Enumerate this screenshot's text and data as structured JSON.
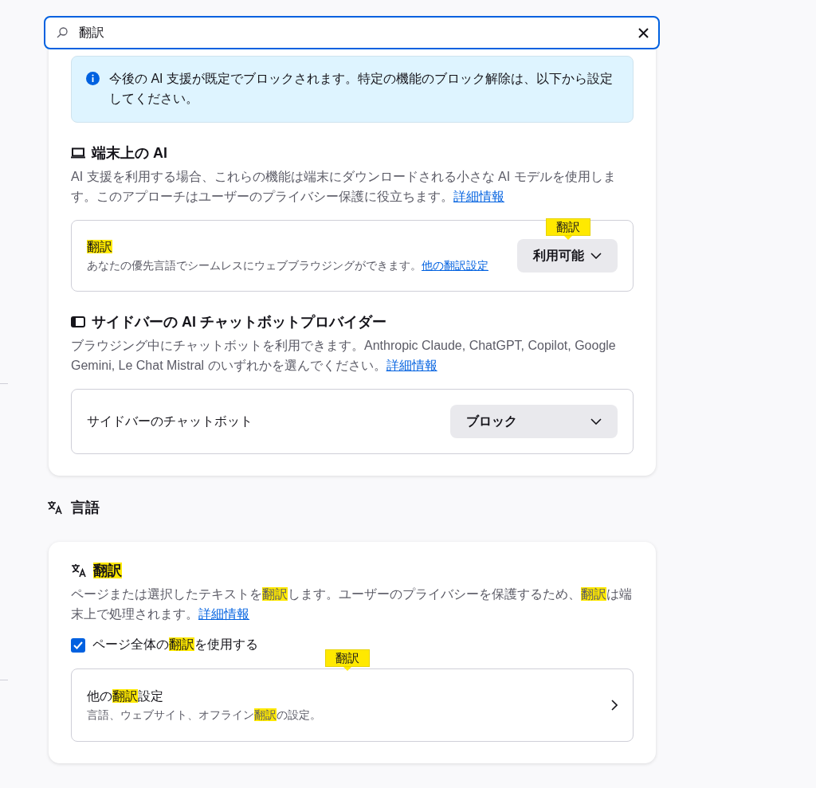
{
  "search": {
    "value": "翻訳"
  },
  "ai_card": {
    "notice": "今後の AI 支援が既定でブロックされます。特定の機能のブロック解除は、以下から設定してください。",
    "sections": [
      {
        "title": "端末上の AI",
        "description": "AI 支援を利用する場合、これらの機能は端末にダウンロードされる小さな AI モデルを使用します。このアプローチはユーザーのプライバシー保護に役立ちます。",
        "link": "詳細情報",
        "setting": {
          "label": [
            {
              "text": "翻訳",
              "highlighted": true
            }
          ],
          "description": "あなたの優先言語でシームレスにウェブブラウジングができます。",
          "link": "他の翻訳設定",
          "dropdown": "利用可能",
          "badge": "翻訳"
        }
      },
      {
        "title": "サイドバーの AI チャットボットプロバイダー",
        "description": "ブラウジング中にチャットボットを利用できます。Anthropic Claude, ChatGPT, Copilot, Google Gemini, Le Chat Mistral のいずれかを選んでください。",
        "link": "詳細情報",
        "setting": {
          "label": [
            {
              "text": "サイドバーのチャットボット",
              "highlighted": false
            }
          ],
          "dropdown": "ブロック"
        }
      }
    ]
  },
  "language": {
    "heading": "言語",
    "card": {
      "title": [
        {
          "text": "翻訳",
          "highlighted": true
        }
      ],
      "description": [
        {
          "text": "ページまたは選択したテキストを",
          "highlighted": false
        },
        {
          "text": "翻訳",
          "highlighted": true
        },
        {
          "text": "します。ユーザーのプライバシーを保護するため、",
          "highlighted": false
        },
        {
          "text": "翻訳",
          "highlighted": true
        },
        {
          "text": "は端末上で処理されます。",
          "highlighted": false
        }
      ],
      "link": "詳細情報",
      "checkbox": {
        "label": [
          {
            "text": "ページ全体の",
            "highlighted": false
          },
          {
            "text": "翻訳",
            "highlighted": true
          },
          {
            "text": "を使用する",
            "highlighted": false
          }
        ],
        "checked": true
      },
      "nav_row": {
        "title": [
          {
            "text": "他の",
            "highlighted": false
          },
          {
            "text": "翻訳",
            "highlighted": true
          },
          {
            "text": "設定",
            "highlighted": false
          }
        ],
        "description": [
          {
            "text": "言語、ウェブサイト、オフライン",
            "highlighted": false
          },
          {
            "text": "翻訳",
            "highlighted": true
          },
          {
            "text": "の設定。",
            "highlighted": false
          }
        ],
        "badge": "翻訳"
      }
    }
  }
}
